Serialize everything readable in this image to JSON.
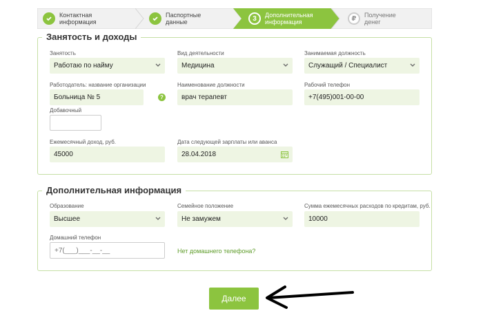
{
  "stepper": {
    "steps": [
      {
        "label_line1": "Контактная",
        "label_line2": "информация",
        "state": "done"
      },
      {
        "label_line1": "Паспортные",
        "label_line2": "данные",
        "state": "done"
      },
      {
        "label_line1": "Дополнительная",
        "label_line2": "информация",
        "state": "current",
        "number": "3"
      },
      {
        "label_line1": "Получение",
        "label_line2": "денег",
        "state": "future",
        "symbol": "₽"
      }
    ]
  },
  "employment": {
    "title": "Занятость и доходы",
    "employment_type": {
      "label": "Занятость",
      "value": "Работаю по найму"
    },
    "activity": {
      "label": "Вид деятельности",
      "value": "Медицина"
    },
    "position": {
      "label": "Занимаемая должность",
      "value": "Служащий / Специалист"
    },
    "employer": {
      "label": "Работодатель: название организации",
      "value": "Больница № 5"
    },
    "job_title": {
      "label": "Наименование должности",
      "value": "врач терапевт"
    },
    "work_phone": {
      "label": "Рабочий телефон",
      "value": "+7(495)001-00-00"
    },
    "extension": {
      "label": "Добавочный",
      "value": ""
    },
    "monthly_income": {
      "label": "Ежемесячный доход, руб.",
      "value": "45000"
    },
    "next_salary_date": {
      "label": "Дата следующей зарплаты или аванса",
      "value": "28.04.2018"
    }
  },
  "additional": {
    "title": "Дополнительная информация",
    "education": {
      "label": "Образование",
      "value": "Высшее"
    },
    "marital": {
      "label": "Семейное положение",
      "value": "Не замужем"
    },
    "credit_expenses": {
      "label": "Сумма ежемесячных расходов по кредитам, руб.",
      "value": "10000"
    },
    "home_phone": {
      "label": "Домашний телефон",
      "value": "+7(___)___-__-__"
    },
    "no_home_phone_link": "Нет домашнего телефона?"
  },
  "actions": {
    "next_label": "Далее"
  },
  "colors": {
    "accent": "#8cc43f",
    "field_bg": "#eef5e3",
    "border": "#c5dfa4"
  }
}
